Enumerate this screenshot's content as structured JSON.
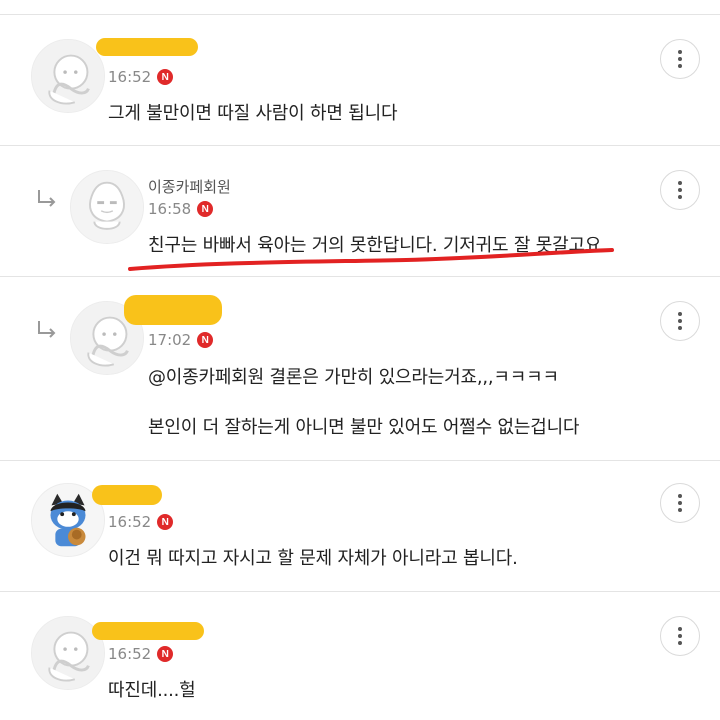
{
  "colors": {
    "highlight": "#f9c21a",
    "badge": "#e02a2a",
    "underline": "#e22222"
  },
  "comments": [
    {
      "time": "16:52",
      "badge": "N",
      "text": "그게 불만이면 따질 사람이 하면 됩니다",
      "avatar_icon": "default-profile-icon"
    },
    {
      "author": "이종카페회원",
      "time": "16:58",
      "badge": "N",
      "text": "친구는 바빠서 육아는 거의 못한답니다. 기저귀도 잘 못갈고요",
      "avatar_icon": "default-profile-icon",
      "is_reply": true
    },
    {
      "time": "17:02",
      "badge": "N",
      "mention": "@이종카페회원",
      "line1_rest": " 결론은 가만히 있으라는거죠,,,ㅋㅋㅋㅋ",
      "line2": "본인이 더 잘하는게 아니면 불만 있어도 어쩔수 없는겁니다",
      "avatar_icon": "default-profile-icon",
      "is_reply": true
    },
    {
      "time": "16:52",
      "badge": "N",
      "text": "이건 뭐 따지고 자시고 할 문제 자체가 아니라고 봅니다.",
      "avatar_icon": "character-profile-icon"
    },
    {
      "time": "16:52",
      "badge": "N",
      "text": "따진데....헐",
      "avatar_icon": "default-profile-icon"
    }
  ]
}
